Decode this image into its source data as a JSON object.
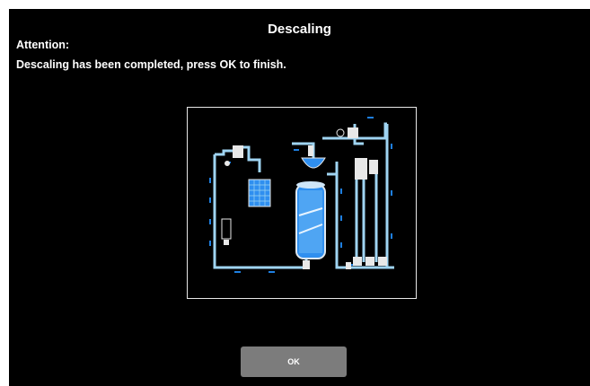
{
  "dialog": {
    "title": "Descaling",
    "attention_label": "Attention:",
    "message": "Descaling has been completed, press OK to finish.",
    "ok_label": "OK"
  },
  "diagram": {
    "pipe_color": "#9fd4f2",
    "water_color": "#2f8ff0",
    "arrow_color": "#1e7fe0"
  }
}
